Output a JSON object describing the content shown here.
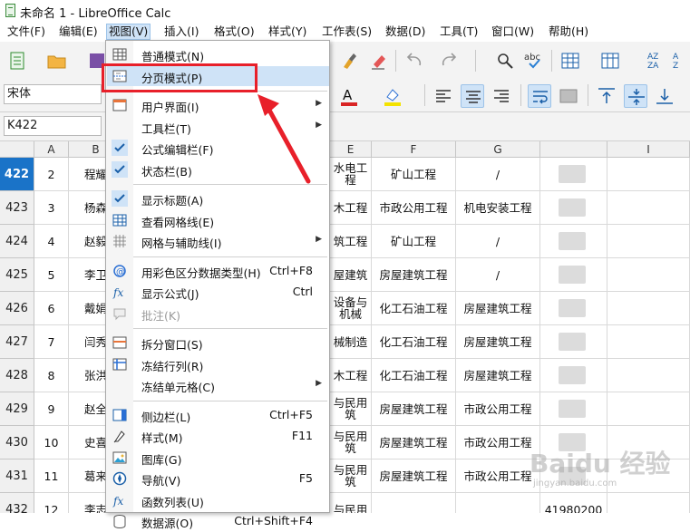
{
  "window": {
    "title": "未命名 1 - LibreOffice Calc"
  },
  "menubar": [
    "文件(F)",
    "编辑(E)",
    "视图(V)",
    "插入(I)",
    "格式(O)",
    "样式(Y)",
    "工作表(S)",
    "数据(D)",
    "工具(T)",
    "窗口(W)",
    "帮助(H)"
  ],
  "toolbar": {
    "font_name": "宋体"
  },
  "namebox": {
    "value": "K422"
  },
  "columns": [
    "A",
    "B",
    "E",
    "F",
    "G",
    "I"
  ],
  "rows": [
    {
      "num": "422",
      "a": "2",
      "b": "程耀",
      "e": "水电工程",
      "f": "矿山工程",
      "g": "/"
    },
    {
      "num": "423",
      "a": "3",
      "b": "杨森",
      "e": "木工程",
      "f": "市政公用工程",
      "g": "机电安装工程"
    },
    {
      "num": "424",
      "a": "4",
      "b": "赵毅",
      "e": "筑工程",
      "f": "矿山工程",
      "g": "/"
    },
    {
      "num": "425",
      "a": "5",
      "b": "李卫",
      "e": "屋建筑",
      "f": "房屋建筑工程",
      "g": "/"
    },
    {
      "num": "426",
      "a": "6",
      "b": "戴娟",
      "e": "设备与机械",
      "f": "化工石油工程",
      "g": "房屋建筑工程"
    },
    {
      "num": "427",
      "a": "7",
      "b": "闫秀",
      "e": "械制造",
      "f": "化工石油工程",
      "g": "房屋建筑工程"
    },
    {
      "num": "428",
      "a": "8",
      "b": "张洪",
      "e": "木工程",
      "f": "化工石油工程",
      "g": "房屋建筑工程"
    },
    {
      "num": "429",
      "a": "9",
      "b": "赵全",
      "e": "与民用筑",
      "f": "房屋建筑工程",
      "g": "市政公用工程"
    },
    {
      "num": "430",
      "a": "10",
      "b": "史喜",
      "e": "与民用筑",
      "f": "房屋建筑工程",
      "g": "市政公用工程"
    },
    {
      "num": "431",
      "a": "11",
      "b": "葛来",
      "e": "与民用筑",
      "f": "房屋建筑工程",
      "g": "市政公用工程"
    },
    {
      "num": "432",
      "a": "12",
      "b": "李志",
      "e": "与民用",
      "f": "",
      "g": "",
      "h": "41980200"
    }
  ],
  "view_menu": [
    {
      "label": "普通模式(N)",
      "shortcut": "",
      "icon": "normal-view-icon"
    },
    {
      "label": "分页模式(P)",
      "shortcut": "",
      "icon": "page-break-view-icon",
      "highlighted": true
    },
    {
      "sep": true
    },
    {
      "label": "用户界面(I)",
      "shortcut": "",
      "icon": "user-interface-icon",
      "submenu": true
    },
    {
      "label": "工具栏(T)",
      "shortcut": "",
      "submenu": true
    },
    {
      "label": "公式编辑栏(F)",
      "shortcut": "",
      "checked": true
    },
    {
      "label": "状态栏(B)",
      "shortcut": "",
      "checked": true
    },
    {
      "sep": true
    },
    {
      "label": "显示标题(A)",
      "shortcut": "",
      "checked": true
    },
    {
      "label": "查看网格线(E)",
      "shortcut": "",
      "icon": "grid-lines-icon"
    },
    {
      "label": "网格与辅助线(I)",
      "shortcut": "",
      "icon": "grid-helplines-icon",
      "submenu": true
    },
    {
      "sep": true
    },
    {
      "label": "用彩色区分数据类型(H)",
      "shortcut": "Ctrl+F8",
      "icon": "value-highlight-icon"
    },
    {
      "label": "显示公式(J)",
      "shortcut": "Ctrl",
      "icon": "show-formula-icon"
    },
    {
      "label": "批注(K)",
      "shortcut": "",
      "icon": "comment-icon",
      "disabled": true
    },
    {
      "sep": true
    },
    {
      "label": "拆分窗口(S)",
      "shortcut": "",
      "icon": "split-window-icon"
    },
    {
      "label": "冻结行列(R)",
      "shortcut": "",
      "icon": "freeze-panes-icon"
    },
    {
      "label": "冻结单元格(C)",
      "shortcut": "",
      "submenu": true
    },
    {
      "sep": true
    },
    {
      "label": "侧边栏(L)",
      "shortcut": "Ctrl+F5",
      "icon": "sidebar-icon"
    },
    {
      "label": "样式(M)",
      "shortcut": "F11",
      "icon": "styles-icon"
    },
    {
      "label": "图库(G)",
      "shortcut": "",
      "icon": "gallery-icon"
    },
    {
      "label": "导航(V)",
      "shortcut": "F5",
      "icon": "navigator-icon"
    },
    {
      "label": "函数列表(U)",
      "shortcut": "",
      "icon": "function-list-icon"
    },
    {
      "label": "数据源(O)",
      "shortcut": "Ctrl+Shift+F4",
      "icon": "data-source-icon"
    }
  ],
  "watermark": {
    "text": "Baidu 经验",
    "sub": "jingyan.baidu.com"
  },
  "colors": {
    "accent": "#1a73c8",
    "highlight": "#cfe3f7",
    "annotation": "#e8202a"
  }
}
